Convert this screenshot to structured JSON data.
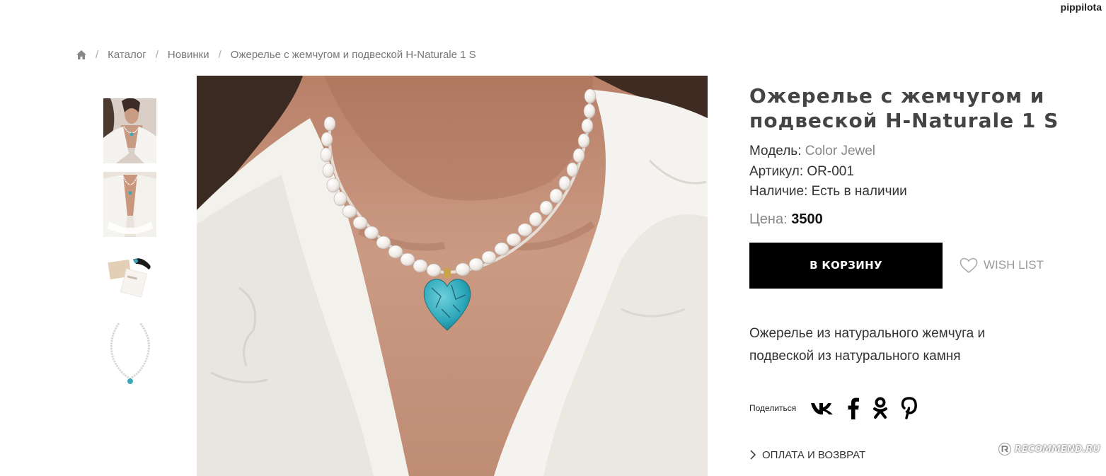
{
  "header": {
    "username": "pippilota"
  },
  "breadcrumb": {
    "home_icon": "home-icon",
    "items": [
      "Каталог",
      "Новинки",
      "Ожерелье с жемчугом и подвеской H-Naturale 1 S"
    ],
    "separator": "/"
  },
  "product": {
    "title": "Ожерелье с жемчугом и подвеской H-Naturale 1 S",
    "model_label": "Модель:",
    "model_value": "Color Jewel",
    "sku_label": "Артикул:",
    "sku_value": "OR-001",
    "availability_label": "Наличие:",
    "availability_value": "Есть в наличии",
    "price_label": "Цена:",
    "price_value": "3500",
    "cart_button": "В КОРЗИНУ",
    "wishlist": "WISH LIST",
    "description": "Ожерелье из натурального жемчуга и подвеской из натурального камня",
    "share_label": "Поделиться",
    "share_icons": [
      "vk-icon",
      "facebook-icon",
      "odnoklassniki-icon",
      "pinterest-icon"
    ],
    "payment_link": "ОПЛАТА И ВОЗВРАТ"
  },
  "gallery": {
    "thumbnail_count": 4
  },
  "watermark": {
    "text": "RECOMMEND.RU"
  },
  "colors": {
    "button_bg": "#000000",
    "muted": "#888888",
    "turquoise": "#3aa8b8"
  }
}
